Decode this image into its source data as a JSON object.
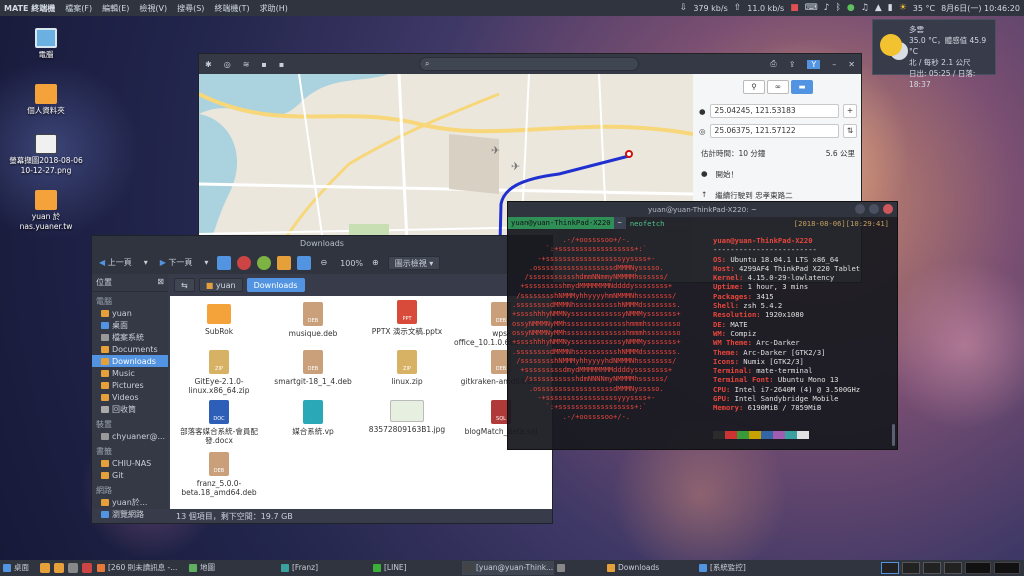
{
  "top_panel": {
    "menus": [
      "MATE 終端機",
      "檔案(F)",
      "編輯(E)",
      "檢視(V)",
      "搜尋(S)",
      "終端機(T)",
      "求助(H)"
    ],
    "net_down": "379 kb/s",
    "net_up": "11.0 kb/s",
    "temp": "35 °C",
    "clock": "8月6日(一) 10:46:20"
  },
  "desktop_icons": [
    "電腦",
    "個人資料夾",
    "螢幕擷圖2018-08-06 10-12-27.png",
    "yuan 於 nas.yuaner.tw"
  ],
  "weather": {
    "condition": "多雲",
    "detail": "35.0 °C，體感值 45.9 °C",
    "wind": "北 / 每秒 2.1 公尺",
    "sun": "日出: 05:25 / 日落: 18:37"
  },
  "map_window": {
    "route": {
      "from": "25.04245, 121.53183",
      "to": "25.06375, 121.57122",
      "summary_time": "估計時間：10 分鐘",
      "summary_distance": "5.6 公里",
      "steps": [
        "開始！",
        "繼續行駛到 忠孝東路二"
      ]
    }
  },
  "file_manager": {
    "title": "Downloads",
    "back_label": "上一頁",
    "forward_label": "下一頁",
    "zoom": "100%",
    "view_mode": "圖示檢視",
    "sidebar": {
      "header": "位置",
      "sections": [
        {
          "name": "電腦",
          "items": [
            "yuan",
            "桌面",
            "檔案系統",
            "Documents",
            "Downloads",
            "Music",
            "Pictures",
            "Videos",
            "回收筒"
          ]
        },
        {
          "name": "裝置",
          "items": [
            "chyuaner@..."
          ]
        },
        {
          "name": "書籤",
          "items": [
            "CHIU-NAS",
            "Git"
          ]
        },
        {
          "name": "網路",
          "items": [
            "yuan於...",
            "瀏覽網路"
          ]
        }
      ]
    },
    "path": [
      "yuan",
      "Downloads"
    ],
    "files": [
      {
        "name": "SubRok",
        "type": "folder"
      },
      {
        "name": "musique.deb",
        "type": "deb"
      },
      {
        "name": "PPTX 演示文稿.pptx",
        "type": "ppt"
      },
      {
        "name": "wps-office_10.1.0.6634_amd64.deb",
        "type": "deb"
      },
      {
        "name": "GitEye-2.1.0-linux.x86_64.zip",
        "type": "zip"
      },
      {
        "name": "smartgit-18_1_4.deb",
        "type": "deb"
      },
      {
        "name": "linux.zip",
        "type": "zip"
      },
      {
        "name": "gitkraken-amd64.deb",
        "type": "deb"
      },
      {
        "name": "部落客媒合系統-會員配發.docx",
        "type": "doc"
      },
      {
        "name": "媒合系統.vp",
        "type": "vp"
      },
      {
        "name": "83572809163B1.jpg",
        "type": "jpg"
      },
      {
        "name": "blogMatch_data.sql",
        "type": "sql"
      },
      {
        "name": "franz_5.0.0-beta.18_amd64.deb",
        "type": "deb"
      }
    ],
    "status": "13 個項目，剩下空間：19.7 GB"
  },
  "terminal": {
    "title": "yuan@yuan-ThinkPad-X220: ~",
    "prompt_user": "yuan@yuan-ThinkPad-X220",
    "prompt_dir": "~",
    "command": "neofetch",
    "timestamp": "[2018-08-06][10:29:41]",
    "user_host": "yuan@yuan-ThinkPad-X220",
    "separator": "------------------------",
    "info": [
      {
        "key": "OS",
        "value": "Ubuntu 18.04.1 LTS x86_64"
      },
      {
        "key": "Host",
        "value": "4299AF4 ThinkPad X220 Tablet"
      },
      {
        "key": "Kernel",
        "value": "4.15.0-29-lowlatency"
      },
      {
        "key": "Uptime",
        "value": "1 hour, 3 mins"
      },
      {
        "key": "Packages",
        "value": "3415"
      },
      {
        "key": "Shell",
        "value": "zsh 5.4.2"
      },
      {
        "key": "Resolution",
        "value": "1920x1080"
      },
      {
        "key": "DE",
        "value": "MATE"
      },
      {
        "key": "WM",
        "value": "Compiz"
      },
      {
        "key": "WM Theme",
        "value": "Arc-Darker"
      },
      {
        "key": "Theme",
        "value": "Arc-Darker [GTK2/3]"
      },
      {
        "key": "Icons",
        "value": "Numix [GTK2/3]"
      },
      {
        "key": "Terminal",
        "value": "mate-terminal"
      },
      {
        "key": "Terminal Font",
        "value": "Ubuntu Mono 13"
      },
      {
        "key": "CPU",
        "value": "Intel i7-2640M (4) @ 3.500GHz"
      },
      {
        "key": "GPU",
        "value": "Intel Sandybridge Mobile"
      },
      {
        "key": "Memory",
        "value": "6190MiB / 7859MiB"
      }
    ],
    "ascii_art": "            .-/+oossssoo+/-.\n        `:+ssssssssssssssssss+:`\n      -+ssssssssssssssssssyyssss+-\n    .ossssssssssssssssssdMMMNysssso.\n   /ssssssssssshdmmNNmmyNMMMMhssssss/\n  +ssssssssshmydMMMMMMMNddddyssssssss+\n /sssssssshNMMMyhhyyyyhmNMMMNhssssssss/\n.ssssssssdMMMNhsssssssssshNMMMdssssssss.\n+sssshhhyNMMNyssssssssssssyNMMMysssssss+\nossyNMMMNyMMhsssssssssssssshmmmhssssssso\nossyNMMMNyMMhsssssssssssssshmmmhssssssso\n+sssshhhyNMMNyssssssssssssyNMMMysssssss+\n.ssssssssdMMMNhsssssssssshNMMMdssssssss.\n /sssssssshNMMMyhhyyyyhdNMMMNhssssssss/\n  +sssssssssdmydMMMMMMMMddddyssssssss+\n   /ssssssssssshdmNNNNmyNMMMMhssssss/\n    .ossssssssssssssssssdMMMNysssso.\n      -+sssssssssssssssssyyyssss+-\n        `:+ssssssssssssssssss+:`\n            .-/+oossssoo+/-.",
    "palette": [
      "#2b2b2b",
      "#cc3333",
      "#3a9a3a",
      "#c8a000",
      "#3465a4",
      "#a05cb0",
      "#3aa0a0",
      "#e0e0e0"
    ]
  },
  "taskbar": {
    "show_desktop": "桌面",
    "tasks": [
      "[260 則未讀訊息 -...",
      "地圖",
      "[Franz]",
      "[LINE]",
      "[yuan@yuan-Think...",
      "",
      "Downloads",
      "[系統監控]"
    ]
  }
}
